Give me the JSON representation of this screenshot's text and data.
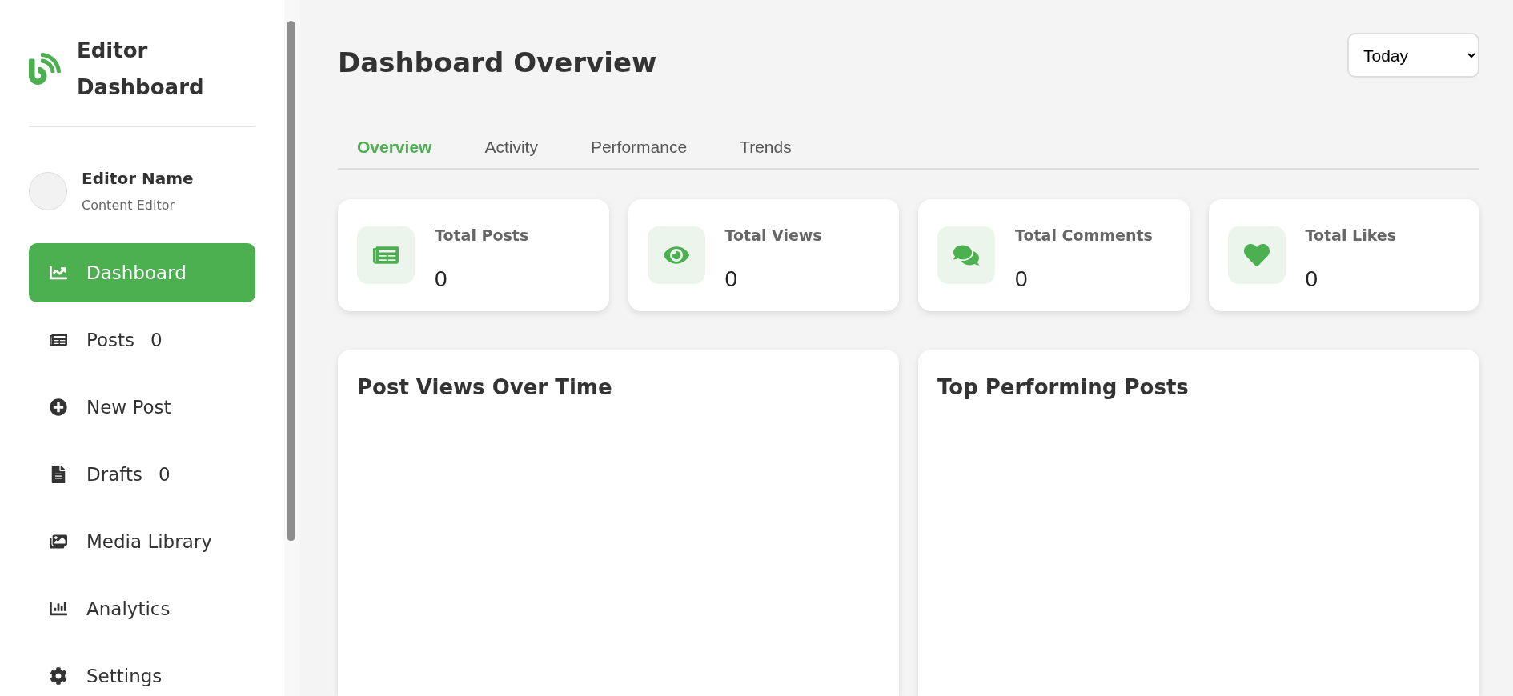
{
  "sidebar": {
    "brand": {
      "title": "Editor Dashboard"
    },
    "profile": {
      "name": "Editor Name",
      "role": "Content Editor"
    },
    "items": [
      {
        "label": "Dashboard",
        "selected": true
      },
      {
        "label": "Posts",
        "count": "0",
        "selected": false
      },
      {
        "label": "New Post",
        "selected": false
      },
      {
        "label": "Drafts",
        "count": "0",
        "selected": false
      },
      {
        "label": "Media Library",
        "selected": false
      },
      {
        "label": "Analytics",
        "selected": false
      },
      {
        "label": "Settings",
        "selected": false
      }
    ]
  },
  "header": {
    "title": "Dashboard Overview",
    "period": "Today"
  },
  "tabs": [
    {
      "label": "Overview",
      "selected": true
    },
    {
      "label": "Activity",
      "selected": false
    },
    {
      "label": "Performance",
      "selected": false
    },
    {
      "label": "Trends",
      "selected": false
    }
  ],
  "stats": [
    {
      "label": "Total Posts",
      "value": "0"
    },
    {
      "label": "Total Views",
      "value": "0"
    },
    {
      "label": "Total Comments",
      "value": "0"
    },
    {
      "label": "Total Likes",
      "value": "0"
    }
  ],
  "panels": [
    {
      "title": "Post Views Over Time"
    },
    {
      "title": "Top Performing Posts"
    }
  ]
}
